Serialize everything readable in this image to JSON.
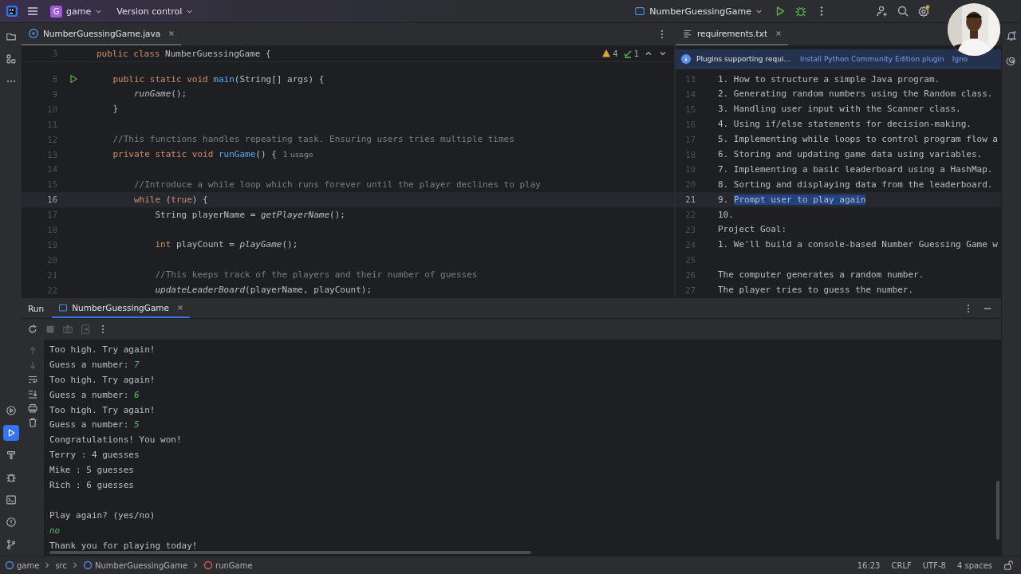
{
  "toolbar": {
    "project": {
      "initial": "G",
      "name": "game"
    },
    "vcs": "Version control",
    "run_config": "NumberGuessingGame"
  },
  "left_tools": [
    {
      "kind": "folder",
      "selected": false
    },
    {
      "kind": "structure",
      "selected": false
    },
    {
      "kind": "more",
      "selected": false
    }
  ],
  "bottom_tools": [
    {
      "kind": "services",
      "selected": false
    },
    {
      "kind": "run",
      "selected": true
    },
    {
      "kind": "build",
      "selected": false
    },
    {
      "kind": "debug",
      "selected": false
    },
    {
      "kind": "terminal",
      "selected": false
    },
    {
      "kind": "problems",
      "selected": false
    },
    {
      "kind": "git",
      "selected": false
    }
  ],
  "editor": {
    "tabs": [
      {
        "label": "NumberGuessingGame.java",
        "selected": true
      }
    ],
    "inspections": {
      "warnings": "4",
      "weak": "1"
    },
    "sticky": {
      "number": "3",
      "tokens": [
        {
          "text": "public class ",
          "kind": "keyword"
        },
        {
          "text": "NumberGuessingGame {",
          "kind": "plain"
        }
      ]
    },
    "lines": [
      {
        "number": "8",
        "run_marker": true,
        "current": false,
        "tokens": [
          {
            "text": "    public static void ",
            "kind": "keyword"
          },
          {
            "text": "main",
            "kind": "declaration"
          },
          {
            "text": "(String[] args) {",
            "kind": "plain"
          }
        ]
      },
      {
        "number": "9",
        "run_marker": false,
        "current": false,
        "tokens": [
          {
            "text": "        runGame",
            "kind": "call"
          },
          {
            "text": "();",
            "kind": "plain"
          }
        ]
      },
      {
        "number": "10",
        "run_marker": false,
        "current": false,
        "tokens": [
          {
            "text": "    }",
            "kind": "plain"
          }
        ]
      },
      {
        "number": "11",
        "run_marker": false,
        "current": false
      },
      {
        "number": "12",
        "run_marker": false,
        "current": false,
        "tokens": [
          {
            "text": "    //This functions handles repeating task. Ensuring users tries multiple times",
            "kind": "comment"
          }
        ]
      },
      {
        "number": "13",
        "run_marker": false,
        "current": false,
        "tokens": [
          {
            "text": "    private static void ",
            "kind": "keyword"
          },
          {
            "text": "runGame",
            "kind": "declaration"
          },
          {
            "text": "() {",
            "kind": "plain"
          }
        ],
        "hint": "1 usage"
      },
      {
        "number": "14",
        "run_marker": false,
        "current": false
      },
      {
        "number": "15",
        "run_marker": false,
        "current": false,
        "tokens": [
          {
            "text": "        //Introduce a while loop which runs forever until the player declines to play",
            "kind": "comment"
          }
        ]
      },
      {
        "number": "16",
        "run_marker": false,
        "current": true,
        "tokens": [
          {
            "text": "        while ",
            "kind": "keyword"
          },
          {
            "text": "(",
            "kind": "plain"
          },
          {
            "text": "true",
            "kind": "keyword"
          },
          {
            "text": ") {",
            "kind": "plain"
          }
        ]
      },
      {
        "number": "17",
        "run_marker": false,
        "current": false,
        "tokens": [
          {
            "text": "            String playerName = ",
            "kind": "plain"
          },
          {
            "text": "getPlayerName",
            "kind": "call"
          },
          {
            "text": "();",
            "kind": "plain"
          }
        ]
      },
      {
        "number": "18",
        "run_marker": false,
        "current": false
      },
      {
        "number": "19",
        "run_marker": false,
        "current": false,
        "tokens": [
          {
            "text": "            int ",
            "kind": "keyword"
          },
          {
            "text": "playCount = ",
            "kind": "plain"
          },
          {
            "text": "playGame",
            "kind": "call"
          },
          {
            "text": "();",
            "kind": "plain"
          }
        ]
      },
      {
        "number": "20",
        "run_marker": false,
        "current": false
      },
      {
        "number": "21",
        "run_marker": false,
        "current": false,
        "tokens": [
          {
            "text": "            //This keeps track of the players and their number of guesses",
            "kind": "comment"
          }
        ]
      },
      {
        "number": "22",
        "run_marker": false,
        "current": false,
        "tokens": [
          {
            "text": "            updateLeaderBoard",
            "kind": "call"
          },
          {
            "text": "(playerName, playCount);",
            "kind": "plain"
          }
        ]
      }
    ]
  },
  "side_editor": {
    "tabs": [
      {
        "label": "requirements.txt",
        "selected": true
      }
    ],
    "banner": {
      "message": "Plugins supporting requi...",
      "action": "Install Python Community Edition plugin",
      "dismiss": "Igno"
    },
    "lines": [
      {
        "number": "13",
        "current": false,
        "text": "1. How to structure a simple Java program."
      },
      {
        "number": "14",
        "current": false,
        "text": "2. Generating random numbers using the Random class."
      },
      {
        "number": "15",
        "current": false,
        "text": "3. Handling user input with the Scanner class."
      },
      {
        "number": "16",
        "current": false,
        "text": "4. Using if/else statements for decision-making."
      },
      {
        "number": "17",
        "current": false,
        "text": "5. Implementing while loops to control program flow a"
      },
      {
        "number": "18",
        "current": false,
        "text": "6. Storing and updating game data using variables."
      },
      {
        "number": "19",
        "current": false,
        "text": "7. Implementing a basic leaderboard using a HashMap."
      },
      {
        "number": "20",
        "current": false,
        "text": "8. Sorting and displaying data from the leaderboard."
      },
      {
        "number": "21",
        "current": true,
        "text": "9. ",
        "selection": "Prompt user to play again"
      },
      {
        "number": "22",
        "current": false,
        "text": "10."
      },
      {
        "number": "23",
        "current": false,
        "text": "Project Goal:"
      },
      {
        "number": "24",
        "current": false,
        "text": "1. We'll build a console-based Number Guessing Game w"
      },
      {
        "number": "25",
        "current": false
      },
      {
        "number": "26",
        "current": false,
        "text": "The computer generates a random number."
      },
      {
        "number": "27",
        "current": false,
        "text": "The player tries to guess the number."
      }
    ]
  },
  "run_panel": {
    "title": "Run",
    "tabs": [
      {
        "label": "NumberGuessingGame",
        "selected": true
      }
    ],
    "output": [
      {
        "parts": [
          {
            "text": "Too high. Try again!",
            "kind": "output"
          }
        ]
      },
      {
        "parts": [
          {
            "text": "Guess a number: ",
            "kind": "output"
          },
          {
            "text": "7",
            "kind": "input"
          }
        ]
      },
      {
        "parts": [
          {
            "text": "Too high. Try again!",
            "kind": "output"
          }
        ]
      },
      {
        "parts": [
          {
            "text": "Guess a number: ",
            "kind": "output"
          },
          {
            "text": "6",
            "kind": "input"
          }
        ]
      },
      {
        "parts": [
          {
            "text": "Too high. Try again!",
            "kind": "output"
          }
        ]
      },
      {
        "parts": [
          {
            "text": "Guess a number: ",
            "kind": "output"
          },
          {
            "text": "5",
            "kind": "input"
          }
        ]
      },
      {
        "parts": [
          {
            "text": "Congratulations! You won!",
            "kind": "output"
          }
        ]
      },
      {
        "parts": [
          {
            "text": "Terry : 4 guesses",
            "kind": "output"
          }
        ]
      },
      {
        "parts": [
          {
            "text": "Mike : 5 guesses",
            "kind": "output"
          }
        ]
      },
      {
        "parts": [
          {
            "text": "Rich : 6 guesses",
            "kind": "output"
          }
        ]
      },
      {
        "gap_before": true,
        "parts": [
          {
            "text": "Play again? (yes/no)",
            "kind": "output"
          }
        ]
      },
      {
        "parts": [
          {
            "text": "no",
            "kind": "input"
          }
        ]
      },
      {
        "parts": [
          {
            "text": "Thank you for playing today!",
            "kind": "output"
          }
        ]
      }
    ]
  },
  "status_bar": {
    "breadcrumbs": [
      {
        "label": "game",
        "kind": "module"
      },
      {
        "label": "src",
        "kind": "folder"
      },
      {
        "label": "NumberGuessingGame",
        "kind": "class"
      },
      {
        "label": "runGame",
        "kind": "method"
      }
    ],
    "position": "16:23",
    "line_endings": "CRLF",
    "encoding": "UTF-8",
    "indent": "4 spaces"
  }
}
